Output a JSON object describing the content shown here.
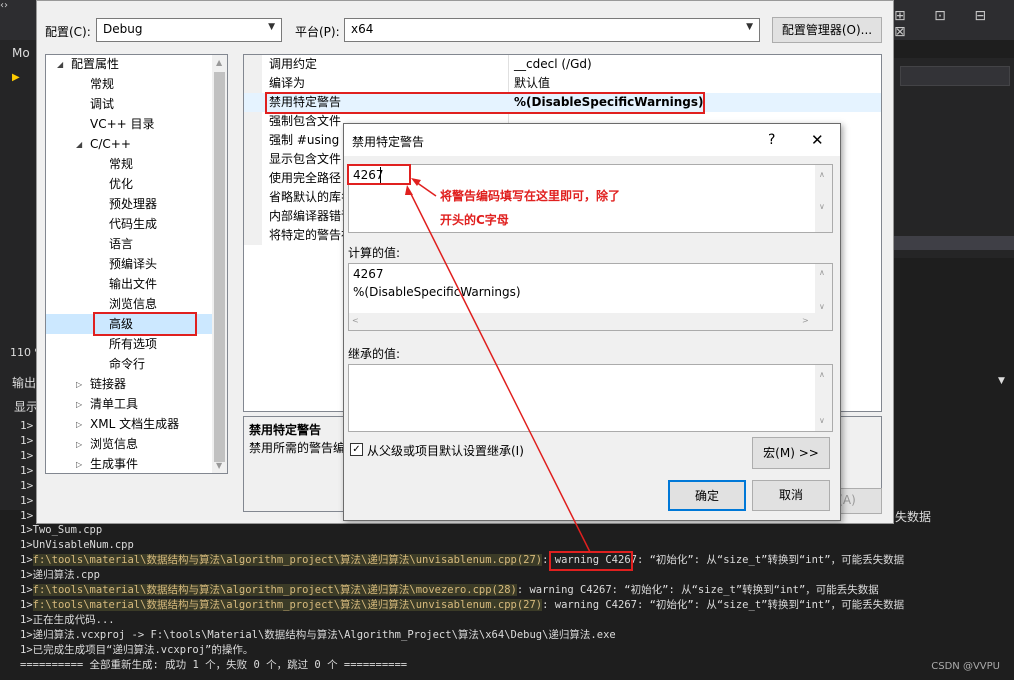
{
  "vs": {
    "tab_partial": "Mo",
    "zoom_partial": "110 %",
    "output_label_partial": "输出",
    "show_label_partial": "显示",
    "left_lines": [
      "1>",
      "1>",
      "1>",
      "1>",
      "1>",
      "1>",
      "1>"
    ],
    "right_text_partial": "失数据",
    "apply_partial": "用(A)",
    "toolbar_icons": "⊞ ⊡ ⊟ ⊠"
  },
  "prop_dialog": {
    "config_label": "配置(C):",
    "config_value": "Debug",
    "platform_label": "平台(P):",
    "platform_value": "x64",
    "config_manager_label": "配置管理器(O)...",
    "tree": {
      "root": "配置属性",
      "items": [
        "常规",
        "调试",
        "VC++ 目录",
        "C/C++",
        "常规",
        "优化",
        "预处理器",
        "代码生成",
        "语言",
        "预编译头",
        "输出文件",
        "浏览信息",
        "高级",
        "所有选项",
        "命令行",
        "链接器",
        "清单工具",
        "XML 文档生成器",
        "浏览信息",
        "生成事件"
      ]
    },
    "grid_rows": [
      {
        "name": "调用约定",
        "value": "__cdecl (/Gd)"
      },
      {
        "name": "编译为",
        "value": "默认值"
      },
      {
        "name": "禁用特定警告",
        "value": "%(DisableSpecificWarnings)"
      },
      {
        "name": "强制包含文件",
        "value": ""
      },
      {
        "name": "强制 #using 文",
        "value": ""
      },
      {
        "name": "显示包含文件",
        "value": ""
      },
      {
        "name": "使用完全路径",
        "value": ""
      },
      {
        "name": "省略默认的库名",
        "value": ""
      },
      {
        "name": "内部编译器错误",
        "value": ""
      },
      {
        "name": "将特定的警告视",
        "value": ""
      }
    ],
    "desc_title": "禁用特定警告",
    "desc_text": "禁用所需的警告编"
  },
  "sub_dialog": {
    "title": "禁用特定警告",
    "help": "?",
    "close": "✕",
    "input_value": "4267",
    "computed_label": "计算的值:",
    "computed_lines": [
      "4267",
      "%(DisableSpecificWarnings)"
    ],
    "inherited_label": "继承的值:",
    "inherit_checkbox_label": "从父级或项目默认设置继承(I)",
    "macro_button": "宏(M) >>",
    "ok_button": "确定",
    "cancel_button": "取消"
  },
  "annotation": {
    "line1": "将警告编码填写在这里即可，除了",
    "line2": "开头的C字母"
  },
  "output": {
    "lines": [
      "1>Two_Sum.cpp",
      "1>UnVisableNum.cpp",
      "1>f:\\tools\\material\\数据结构与算法\\algorithm_project\\算法\\递归算法\\unvisablenum.cpp(27): warning C4267: “初始化”: 从“size_t”转换到“int”，可能丢失数据",
      "1>递归算法.cpp",
      "1>f:\\tools\\material\\数据结构与算法\\algorithm_project\\算法\\递归算法\\movezero.cpp(28): warning C4267: “初始化”: 从“size_t”转换到“int”，可能丢失数据",
      "1>f:\\tools\\material\\数据结构与算法\\algorithm_project\\算法\\递归算法\\unvisablenum.cpp(27): warning C4267: “初始化”: 从“size_t”转换到“int”，可能丢失数据",
      "1>正在生成代码...",
      "1>递归算法.vcxproj -> F:\\tools\\Material\\数据结构与算法\\Algorithm_Project\\算法\\x64\\Debug\\递归算法.exe",
      "1>已完成生成项目“递归算法.vcxproj”的操作。",
      "========== 全部重新生成: 成功 1 个，失败 0 个，跳过 0 个 =========="
    ],
    "watermark": "CSDN @VVPU"
  }
}
